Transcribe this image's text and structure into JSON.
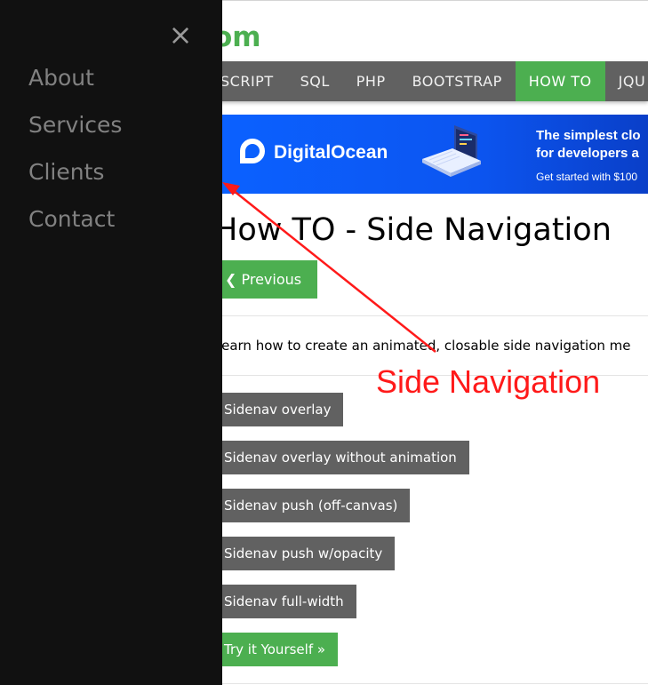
{
  "logo": {
    "text": "om"
  },
  "topnav": {
    "items": [
      {
        "label": "SCRIPT"
      },
      {
        "label": "SQL"
      },
      {
        "label": "PHP"
      },
      {
        "label": "BOOTSTRAP"
      },
      {
        "label": "HOW TO",
        "active": true
      },
      {
        "label": "JQU"
      }
    ],
    "accent_color": "#4CAF50"
  },
  "ad": {
    "brand": "DigitalOcean",
    "headline": "The simplest clo\nfor developers a",
    "subline": "Get started with $100"
  },
  "page": {
    "title": "How TO - Side Navigation",
    "previous_label": "❮ Previous",
    "intro": "Learn how to create an animated, closable side navigation me",
    "buttons": [
      {
        "label": "Sidenav overlay"
      },
      {
        "label": "Sidenav overlay without animation"
      },
      {
        "label": "Sidenav push (off-canvas)"
      },
      {
        "label": "Sidenav push w/opacity"
      },
      {
        "label": "Sidenav full-width"
      },
      {
        "label": "Try it Yourself »"
      }
    ]
  },
  "annotation": {
    "text": "Side Navigation",
    "color": "#ff1a1a"
  },
  "sidenav": {
    "close_icon": "close-icon",
    "close_glyph": "×",
    "links": [
      {
        "label": "About"
      },
      {
        "label": "Services"
      },
      {
        "label": "Clients"
      },
      {
        "label": "Contact"
      }
    ]
  }
}
